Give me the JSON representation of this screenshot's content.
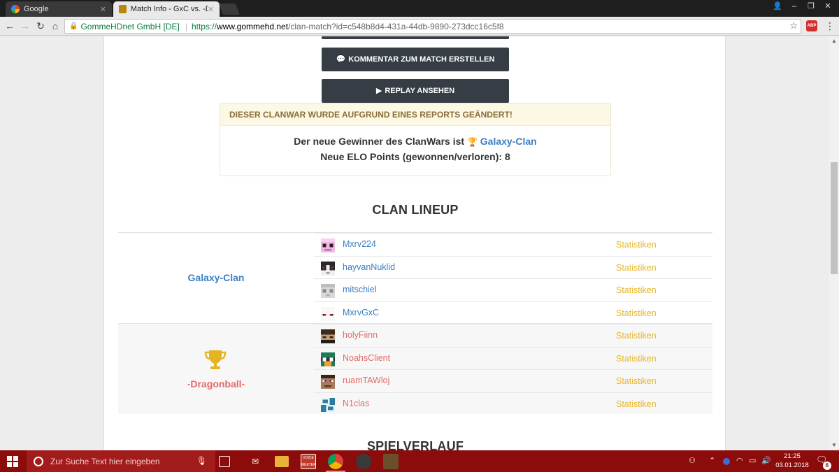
{
  "browser": {
    "tabs": [
      {
        "title": "Google",
        "active": false
      },
      {
        "title": "Match Info - GxC vs. -DB",
        "active": true
      }
    ],
    "secure_label": "GommeHDnet GmbH [DE]",
    "url_proto": "https://",
    "url_host": "www.gommehd.net",
    "url_path": "/clan-match?id=c548b8d4-431a-44db-9890-273dcc16c5f8",
    "abp_label": "ABP"
  },
  "page": {
    "comment_button": "KOMMENTAR ZUM MATCH ERSTELLEN",
    "replay_button": "REPLAY ANSEHEN",
    "notice": {
      "title": "DIESER CLANWAR WURDE AUFGRUND EINES REPORTS GEÄNDERT!",
      "winner_prefix": "Der neue Gewinner des ClanWars ist",
      "winner_name": "Galaxy-Clan",
      "elo_text": "Neue ELO Points (gewonnen/verloren): 8"
    },
    "lineup_title": "CLAN LINEUP",
    "stats_label": "Statistiken",
    "teams": [
      {
        "name": "Galaxy-Clan",
        "color": "#3d7fc1",
        "players": [
          "Mxrv224",
          "hayvanNuklid",
          "mitschiel",
          "MxrvGxC"
        ]
      },
      {
        "name": "-Dragonball-",
        "color": "#e56a6a",
        "players": [
          "holyFiinn",
          "NoahsClient",
          "ruamTAWloj",
          "N1clas"
        ]
      }
    ],
    "next_section_title": "SPIELVERLAUF"
  },
  "taskbar": {
    "search_placeholder": "Zur Suche Text hier eingeben",
    "time": "21:25",
    "date": "03.01.2018",
    "notification_count": "6",
    "voicemeeter_label": "VOICE MEETER"
  }
}
